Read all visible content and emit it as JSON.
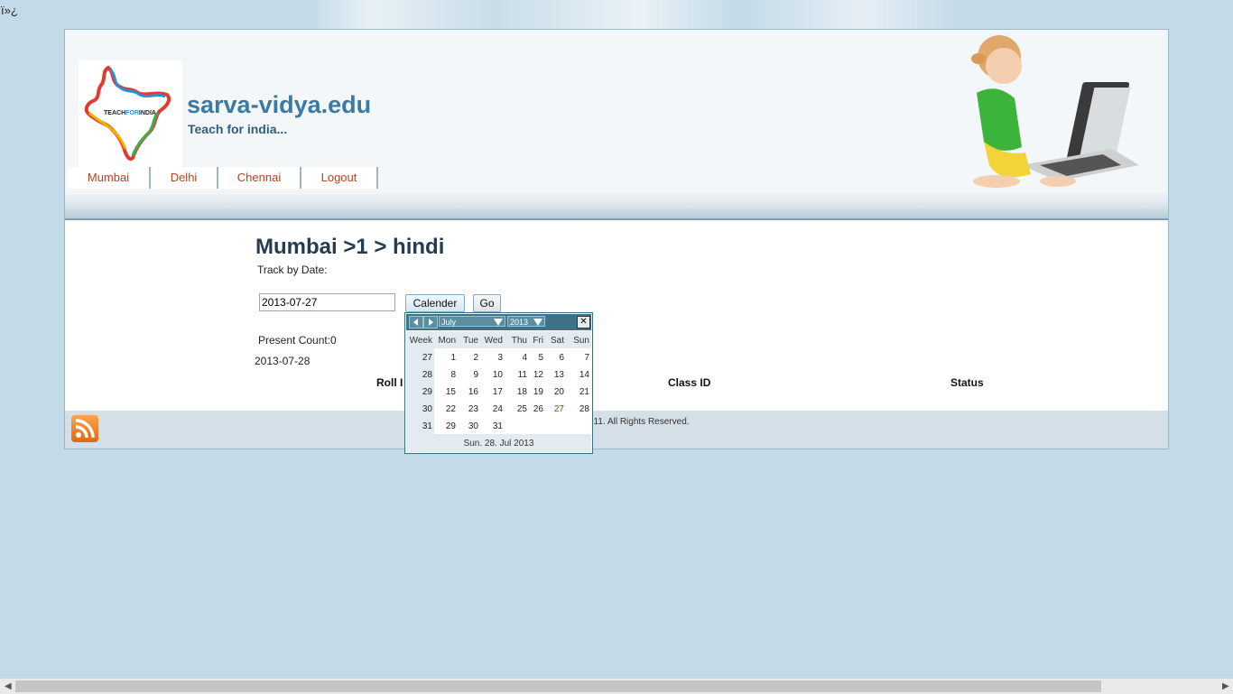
{
  "bom_text": "ï»¿",
  "site": {
    "name": "sarva-vidya.edu",
    "tagline": "Teach for india...",
    "logo_text": {
      "a": "TEACH",
      "b": "FOR",
      "c": "INDIA"
    }
  },
  "nav": [
    {
      "label": "Mumbai"
    },
    {
      "label": "Delhi"
    },
    {
      "label": "Chennai"
    },
    {
      "label": "Logout"
    }
  ],
  "main": {
    "breadcrumb": "Mumbai >1 > hindi",
    "track_label": "Track by Date:",
    "date_value": "2013-07-27",
    "calendar_button": "Calender",
    "go_button": "Go",
    "present_count": "Present Count:0",
    "selected_date": "2013-07-28",
    "table_headers": {
      "roll": "Roll I",
      "class_id": "Class ID",
      "status": "Status"
    }
  },
  "footer": {
    "copyright": "011. All Rights Reserved."
  },
  "calendar": {
    "month": "July",
    "year": "2013",
    "close": "✕",
    "headers": [
      "Week",
      "Mon",
      "Tue",
      "Wed",
      "Thu",
      "Fri",
      "Sat",
      "Sun"
    ],
    "weeks": [
      {
        "wk": "27",
        "days": [
          "1",
          "2",
          "3",
          "4",
          "5",
          "6",
          "7"
        ]
      },
      {
        "wk": "28",
        "days": [
          "8",
          "9",
          "10",
          "11",
          "12",
          "13",
          "14"
        ]
      },
      {
        "wk": "29",
        "days": [
          "15",
          "16",
          "17",
          "18",
          "19",
          "20",
          "21"
        ]
      },
      {
        "wk": "30",
        "days": [
          "22",
          "23",
          "24",
          "25",
          "26",
          "27",
          "28"
        ]
      },
      {
        "wk": "31",
        "days": [
          "29",
          "30",
          "31",
          "",
          "",
          "",
          ""
        ]
      }
    ],
    "highlight_day": "27",
    "highlight_color": "#d0201a",
    "status": "Sun. 28. Jul 2013"
  },
  "colors": {
    "accent": "#3a7aa3",
    "nav_text": "#b0451f",
    "calendar_header": "#3f7286"
  }
}
